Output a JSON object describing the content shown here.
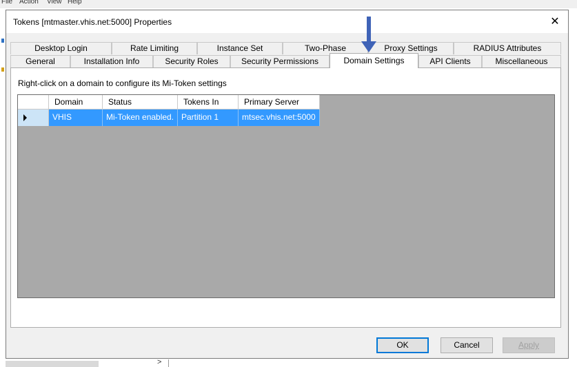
{
  "background": {
    "menu_items": [
      "File",
      "Action",
      "View",
      "Help"
    ]
  },
  "dialog": {
    "title": "Tokens [mtmaster.vhis.net:5000] Properties",
    "close_glyph": "✕"
  },
  "tabs": {
    "row1": [
      "Desktop Login",
      "Rate Limiting",
      "Instance Set",
      "Two-Phase",
      "Proxy Settings",
      "RADIUS Attributes"
    ],
    "row2": [
      "General",
      "Installation Info",
      "Security Roles",
      "Security Permissions",
      "Domain Settings",
      "API Clients",
      "Miscellaneous"
    ],
    "active": "Domain Settings"
  },
  "panel": {
    "hint": "Right-click on a domain to configure its Mi-Token settings"
  },
  "grid": {
    "columns": [
      "Domain",
      "Status",
      "Tokens In",
      "Primary Server"
    ],
    "rows": [
      {
        "domain": "VHIS",
        "status": "Mi-Token enabled.",
        "tokens_in": "Partition 1",
        "primary_server": "mtsec.vhis.net:5000",
        "selected": true
      }
    ]
  },
  "buttons": {
    "ok": "OK",
    "cancel": "Cancel",
    "apply": "Apply"
  },
  "colors": {
    "selection": "#3399ff",
    "annotation_arrow": "#3f63b7",
    "grid_background": "#a9a9a9"
  },
  "icons": {
    "row_pointer": "triangle-right-icon",
    "annotation": "down-arrow-icon"
  }
}
